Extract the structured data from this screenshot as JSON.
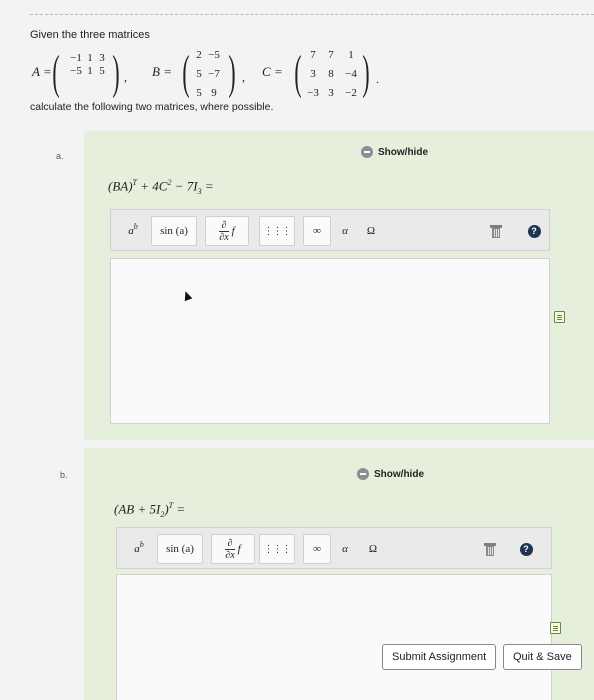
{
  "intro": "Given the three matrices",
  "matrices": {
    "A": {
      "label": "A =",
      "rows": [
        [
          "−1",
          "1",
          "3"
        ],
        [
          "−5",
          "1",
          "5"
        ]
      ]
    },
    "B": {
      "label": "B =",
      "rows": [
        [
          "2",
          "−5"
        ],
        [
          "5",
          "−7"
        ],
        [
          "5",
          "9"
        ]
      ]
    },
    "C": {
      "label": "C =",
      "rows": [
        [
          "7",
          "7",
          "1"
        ],
        [
          "3",
          "8",
          "−4"
        ],
        [
          "−3",
          "3",
          "−2"
        ]
      ]
    }
  },
  "instruction": "calculate the following two matrices, where possible.",
  "parts": [
    {
      "label": "a.",
      "show_hide": "Show/hide",
      "expression": {
        "m1": "(BA)",
        "s1": "T",
        "m2": " + 4C",
        "s2": "2",
        "m3": " − 7I",
        "sub": "3",
        "eq": " ="
      }
    },
    {
      "label": "b.",
      "show_hide": "Show/hide",
      "expression": {
        "m1": "(AB + 5I",
        "sub": "2",
        "m2": ")",
        "s1": "T",
        "eq": " ="
      }
    }
  ],
  "toolbar": {
    "power": {
      "base": "a",
      "exp": "b"
    },
    "sin": "sin (a)",
    "deriv": {
      "num": "∂",
      "den": "∂x",
      "f": "f"
    },
    "matrix_glyph": "⋮⋮⋮",
    "infinity": "∞",
    "alpha": "α",
    "omega": "Ω",
    "help": "?"
  },
  "buttons": {
    "submit": "Submit Assignment",
    "quit": "Quit & Save"
  },
  "colors": {
    "panel": "#e6efdc",
    "help": "#1f3550"
  }
}
